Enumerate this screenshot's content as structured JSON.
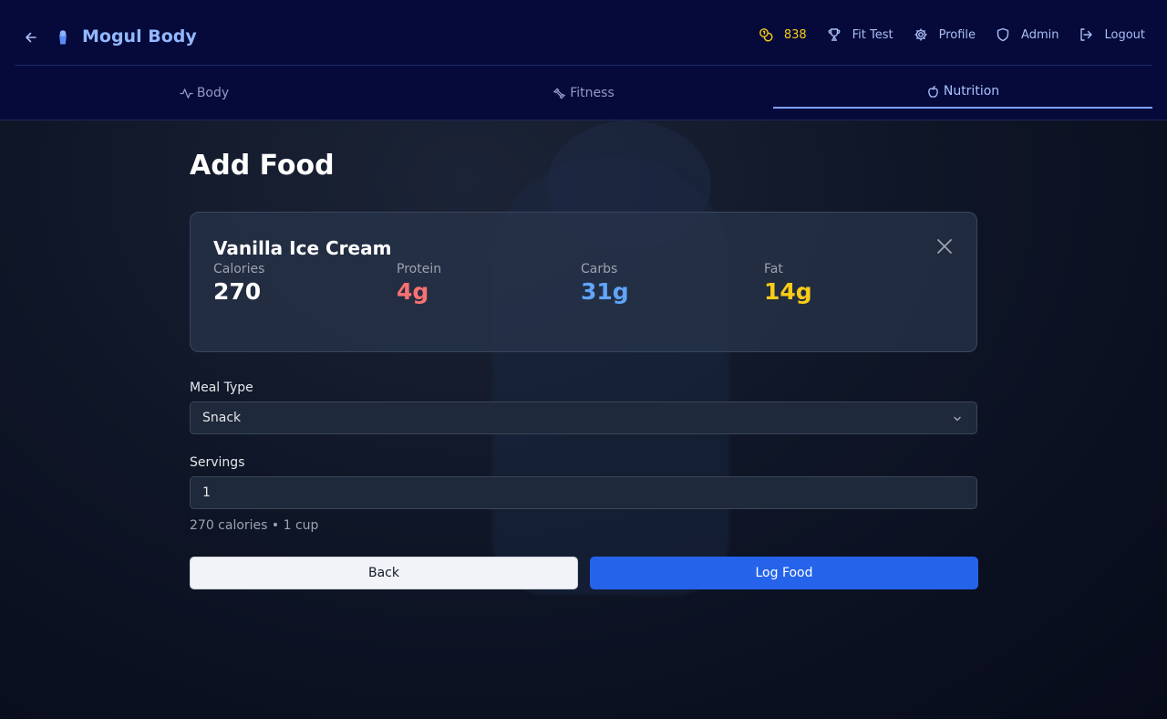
{
  "app": {
    "brand": "Mogul Body",
    "coins": "838",
    "nav": {
      "fit_test": "Fit Test",
      "profile": "Profile",
      "admin": "Admin",
      "logout": "Logout"
    }
  },
  "tabs": [
    {
      "label": "Body",
      "icon": "activity-icon"
    },
    {
      "label": "Fitness",
      "icon": "dumbbell-icon"
    },
    {
      "label": "Nutrition",
      "icon": "apple-icon",
      "active": true
    }
  ],
  "page": {
    "title": "Add Food"
  },
  "food": {
    "name": "Vanilla Ice Cream",
    "macros": {
      "calories": {
        "label": "Calories",
        "value": "270",
        "color": "#ffffff"
      },
      "protein": {
        "label": "Protein",
        "value": "4g",
        "color": "#f87171"
      },
      "carbs": {
        "label": "Carbs",
        "value": "31g",
        "color": "#60a5fa"
      },
      "fat": {
        "label": "Fat",
        "value": "14g",
        "color": "#facc15"
      }
    }
  },
  "form": {
    "meal_type_label": "Meal Type",
    "meal_type_value": "Snack",
    "servings_label": "Servings",
    "servings_value": "1",
    "hint": "270 calories • 1 cup"
  },
  "buttons": {
    "back": "Back",
    "log": "Log Food"
  },
  "colors": {
    "accent": "#2563eb",
    "header_bg": "#060a3a",
    "brand": "#93b8ff",
    "coins": "#facc15"
  }
}
